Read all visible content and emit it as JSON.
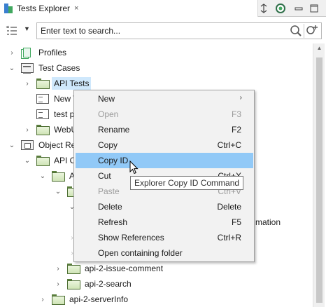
{
  "tab": {
    "title": "Tests Explorer",
    "close": "×"
  },
  "toolbar": {
    "collapse": "⁑",
    "minimize": "▭",
    "maximize": "□"
  },
  "search": {
    "placeholder": "Enter text to search..."
  },
  "tree": {
    "items": [
      {
        "label": "Profiles"
      },
      {
        "label": "Test Cases"
      },
      {
        "label": "API Tests"
      },
      {
        "label": "New T"
      },
      {
        "label": "test p"
      },
      {
        "label": "WebU"
      },
      {
        "label": "Object Re"
      },
      {
        "label": "API O"
      },
      {
        "label": "A"
      },
      {
        "label": "mation"
      },
      {
        "label": "api-2-issue-comment"
      },
      {
        "label": "api-2-search"
      },
      {
        "label": "api-2-serverInfo"
      }
    ]
  },
  "context_menu": {
    "items": [
      {
        "label": "New",
        "shortcut": "",
        "submenu": "›"
      },
      {
        "label": "Open",
        "shortcut": "F3"
      },
      {
        "label": "Rename",
        "shortcut": "F2"
      },
      {
        "label": "Copy",
        "shortcut": "Ctrl+C"
      },
      {
        "label": "Copy ID",
        "shortcut": ""
      },
      {
        "label": "Cut",
        "shortcut": "Ctrl+X"
      },
      {
        "label": "Paste",
        "shortcut": "Ctrl+V"
      },
      {
        "label": "Delete",
        "shortcut": "Delete"
      },
      {
        "label": "Refresh",
        "shortcut": "F5"
      },
      {
        "label": "Show References",
        "shortcut": "Ctrl+R"
      },
      {
        "label": "Open containing folder",
        "shortcut": ""
      }
    ]
  },
  "tooltip": {
    "text": "Explorer Copy ID Command"
  },
  "colors": {
    "selection": "#cfe8fc",
    "menu_highlight": "#91c9f7",
    "menu_bg": "#f2f2f2"
  }
}
